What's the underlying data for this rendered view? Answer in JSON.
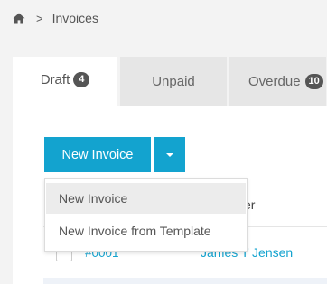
{
  "breadcrumb": {
    "separator": ">",
    "current": "Invoices"
  },
  "tabs": [
    {
      "label": "Draft",
      "count": "4"
    },
    {
      "label": "Unpaid"
    },
    {
      "label": "Overdue",
      "count": "10"
    }
  ],
  "actions": {
    "new_invoice_label": "New Invoice"
  },
  "dropdown": {
    "items": [
      "New Invoice",
      "New Invoice from Template"
    ]
  },
  "table": {
    "column_partial": "er",
    "row": {
      "number": "#0001",
      "customer": "James T Jensen"
    }
  },
  "colors": {
    "accent": "#13a3cf",
    "badge": "#555555",
    "tab_inactive": "#e6e6e6"
  }
}
